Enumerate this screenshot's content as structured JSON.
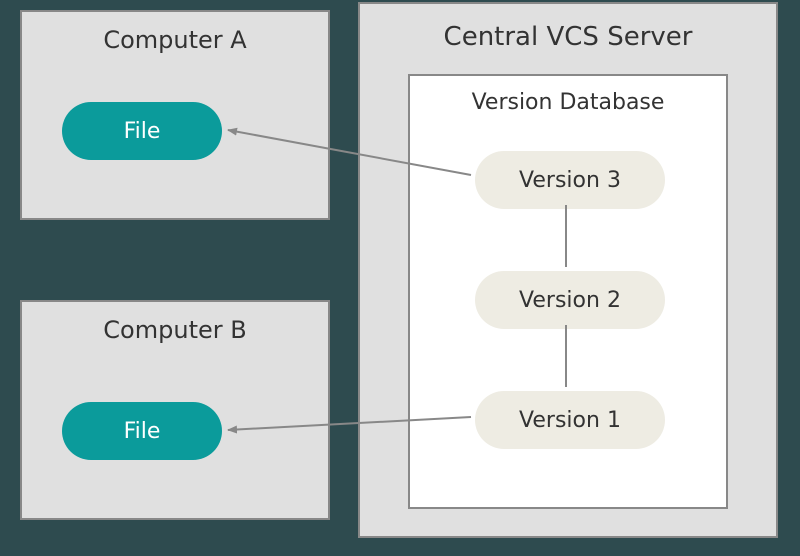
{
  "computer_a": {
    "title": "Computer A",
    "file_label": "File"
  },
  "computer_b": {
    "title": "Computer B",
    "file_label": "File"
  },
  "server": {
    "title": "Central VCS Server",
    "database": {
      "title": "Version Database",
      "versions": {
        "v3": "Version 3",
        "v2": "Version 2",
        "v1": "Version 1"
      }
    }
  },
  "colors": {
    "file_pill": "#0b9b9b",
    "version_pill": "#eeece3",
    "panel": "#e0e0e0",
    "bg": "#2e4b4f"
  }
}
